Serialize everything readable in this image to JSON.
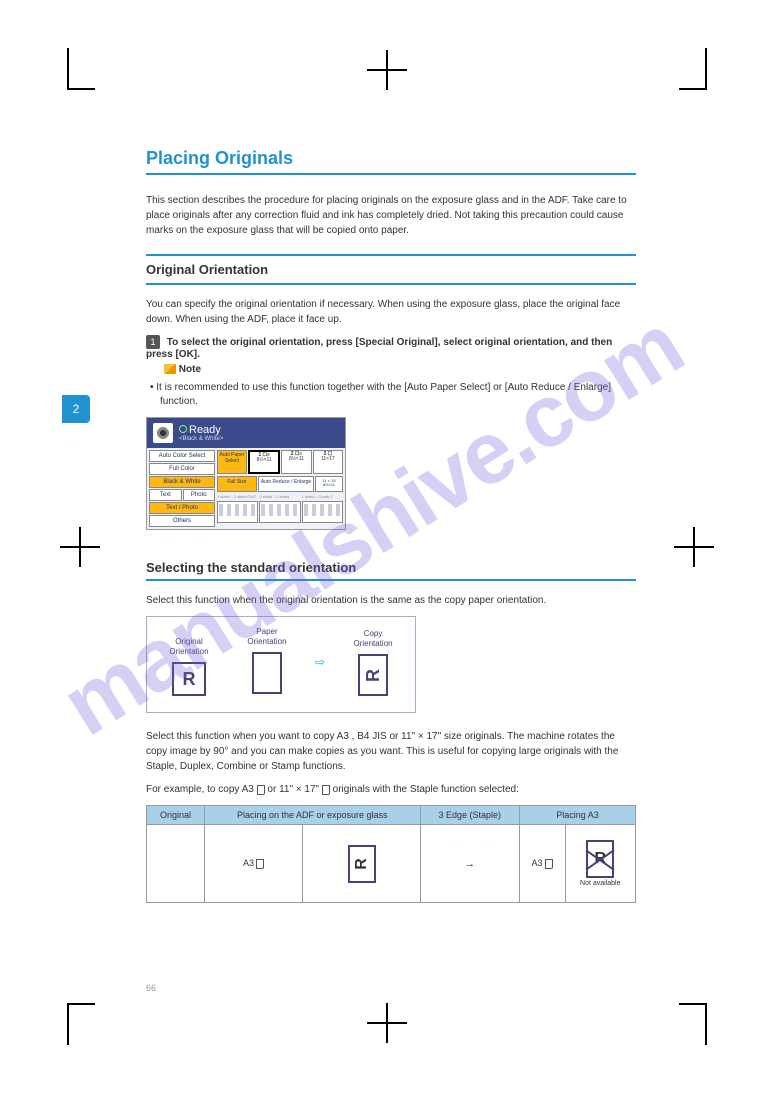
{
  "page_number": "66",
  "side_tab": "2",
  "watermark": "manualshive.com",
  "title": "Placing Originals",
  "intro": "This section describes the procedure for placing originals on the exposure glass and in the ADF.\nTake care to place originals after any correction fluid and ink has completely dried. Not taking this precaution could cause marks on the exposure glass that will be copied onto paper.",
  "subtitle": "Original Orientation",
  "body1": "You can specify the original orientation if necessary.\nWhen using the exposure glass, place the original face down. When using the ADF, place it face up.",
  "step1_label": "To select the original orientation, press [Special Original], select original orientation, and then press [OK].",
  "note_label": "Note",
  "bullet1": "It is recommended to use this function together with the [Auto Paper Select] or [Auto Reduce / Enlarge] function.",
  "ui": {
    "ready": "Ready",
    "sublabel": "<Black & White>",
    "auto_color": "Auto Color Select",
    "full_color": "Full Color",
    "bw": "Black & White",
    "text": "Text",
    "photo": "Photo",
    "textphoto": "Text / Photo",
    "others": "Others",
    "auto_paper": "Auto Paper Select",
    "tray1": "8½×11",
    "tray2": "8½×11",
    "tray3": "11×17",
    "full_size": "Full Size",
    "auto_re": "Auto Reduce / Enlarge",
    "preset": "11 × 15\n8½×11"
  },
  "section2": "Selecting the standard orientation",
  "body2": "Select this function when the original orientation is the same as the copy paper orientation.",
  "orient": {
    "c1": "Original\nOrientation",
    "c2": "Paper\nOrientation",
    "c3": "Copy\nOrientation"
  },
  "body3": "Select this function when you want to copy A3 , B4 JIS  or 11\" × 17\"  size originals. The machine rotates the copy image by 90° and you can make copies as you want. This is useful for copying large originals with the Staple, Duplex, Combine or Stamp functions.",
  "table": {
    "h1": "Original",
    "h2": "Placing on the ADF or exposure glass",
    "h3": "3 Edge (Staple)",
    "h4": "Placing A3 ",
    "r1c1": "A3 ",
    "r1c3": "A3 ",
    "note": "Not available"
  }
}
